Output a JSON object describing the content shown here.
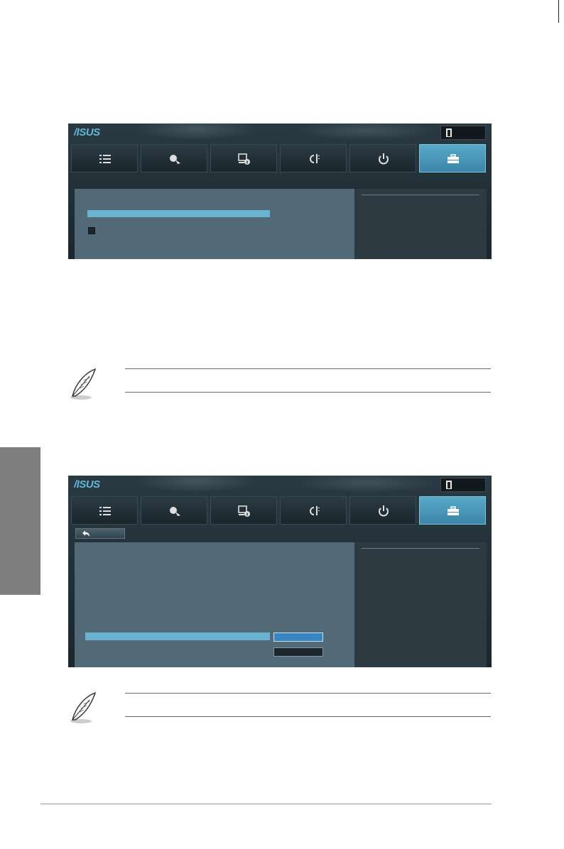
{
  "colors": {
    "accent": "#6ab2d0",
    "panel": "#526978",
    "help_panel": "#2d3a42",
    "bios_bg": "#1f2b33",
    "chapter_tab": "#7f7f7f"
  },
  "screens": [
    {
      "logo": "ASUS",
      "tabs": [
        {
          "icon": "list-icon",
          "active": false
        },
        {
          "icon": "ai-tweaker-icon",
          "active": false
        },
        {
          "icon": "advanced-icon",
          "active": false
        },
        {
          "icon": "monitor-icon",
          "active": false
        },
        {
          "icon": "power-icon",
          "active": false
        },
        {
          "icon": "tool-icon",
          "active": true
        }
      ],
      "highlight_item": "",
      "checkbox": "checked"
    },
    {
      "logo": "ASUS",
      "tabs": [
        {
          "icon": "list-icon",
          "active": false
        },
        {
          "icon": "ai-tweaker-icon",
          "active": false
        },
        {
          "icon": "advanced-icon",
          "active": false
        },
        {
          "icon": "monitor-icon",
          "active": false
        },
        {
          "icon": "power-icon",
          "active": false
        },
        {
          "icon": "tool-icon",
          "active": true
        }
      ],
      "back_icon": "back-arrow-icon",
      "options": [
        "selected",
        "unselected"
      ]
    }
  ],
  "notes": [
    {
      "icon": "feather-note-icon"
    },
    {
      "icon": "feather-note-icon"
    }
  ]
}
